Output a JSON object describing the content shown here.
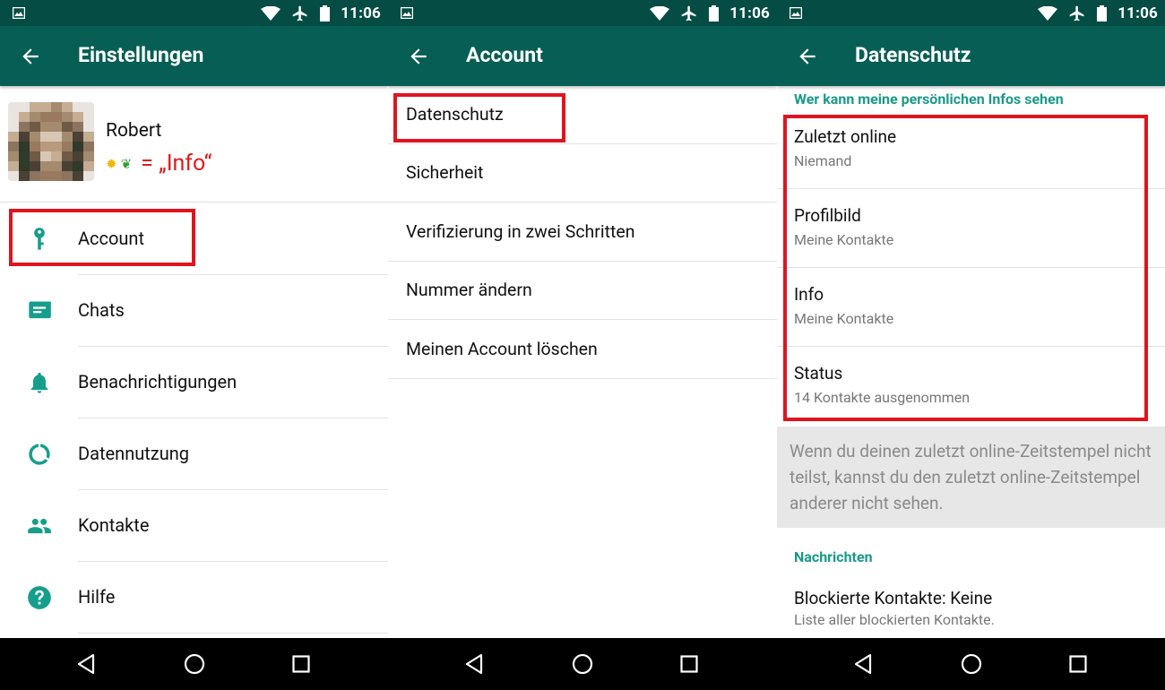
{
  "status_bar": {
    "time": "11:06"
  },
  "settings": {
    "title": "Einstellungen",
    "profile": {
      "name": "Robert",
      "status_text": "= „Info“"
    },
    "items": [
      {
        "label": "Account",
        "icon": "key-icon"
      },
      {
        "label": "Chats",
        "icon": "chat-icon"
      },
      {
        "label": "Benachrichtigungen",
        "icon": "bell-icon"
      },
      {
        "label": "Datennutzung",
        "icon": "data-usage-icon"
      },
      {
        "label": "Kontakte",
        "icon": "contacts-icon"
      },
      {
        "label": "Hilfe",
        "icon": "help-icon"
      }
    ]
  },
  "account": {
    "title": "Account",
    "items": [
      {
        "label": "Datenschutz"
      },
      {
        "label": "Sicherheit"
      },
      {
        "label": "Verifizierung in zwei Schritten"
      },
      {
        "label": "Nummer ändern"
      },
      {
        "label": "Meinen Account löschen"
      }
    ]
  },
  "privacy": {
    "title": "Datenschutz",
    "section_header": "Wer kann meine persönlichen Infos sehen",
    "items": [
      {
        "title": "Zuletzt online",
        "subtitle": "Niemand"
      },
      {
        "title": "Profilbild",
        "subtitle": "Meine Kontakte"
      },
      {
        "title": "Info",
        "subtitle": "Meine Kontakte"
      },
      {
        "title": "Status",
        "subtitle": "14 Kontakte ausgenommen"
      }
    ],
    "info_text": "Wenn du deinen zuletzt online-Zeitstempel nicht teilst, kannst du den zuletzt online-Zeitstempel anderer nicht sehen.",
    "messages_header": "Nachrichten",
    "blocked_title": "Blockierte Kontakte: Keine",
    "blocked_subtitle": "Liste aller blockierten Kontakte."
  },
  "colors": {
    "appbar": "#075e54",
    "statusbar": "#054d44",
    "accent": "#1a9a87",
    "icon": "#169e8c",
    "highlight": "#e0141e"
  }
}
